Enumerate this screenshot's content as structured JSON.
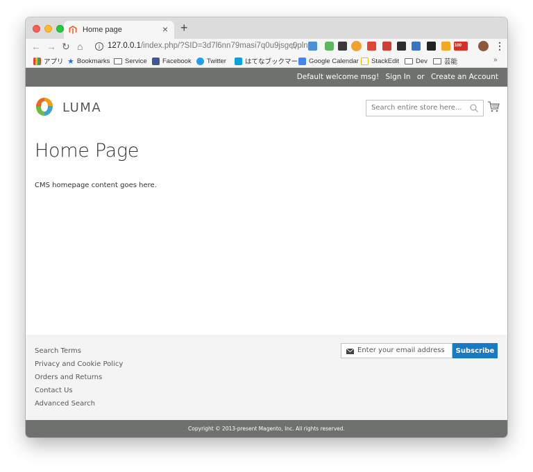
{
  "browser": {
    "tab": {
      "title": "Home page"
    },
    "new_tab_label": "+",
    "address": {
      "host": "127.0.0.1",
      "path": "/index.php/?SID=3d7l6nn79masi7q0u9jsgc0pln"
    },
    "extensions": [
      "puzzle-icon",
      "grid-icon",
      "shield-icon",
      "target-icon",
      "pocket-icon",
      "translate-icon",
      "se-icon",
      "feed-icon",
      "bookmark-icon",
      "graph-icon",
      "gmail-icon",
      "profile-avatar"
    ],
    "gmail_badge": "100",
    "bookmarks": [
      {
        "label": "アプリ",
        "icon": "apps-grid-icon"
      },
      {
        "label": "Bookmarks",
        "icon": "star-icon"
      },
      {
        "label": "Service",
        "icon": "folder-icon"
      },
      {
        "label": "Facebook",
        "icon": "facebook-icon"
      },
      {
        "label": "Twitter",
        "icon": "twitter-icon"
      },
      {
        "label": "はてなブックマーク",
        "icon": "hatena-icon"
      },
      {
        "label": "Google Calendar",
        "icon": "calendar-icon"
      },
      {
        "label": "StackEdit",
        "icon": "stackedit-icon"
      },
      {
        "label": "Dev",
        "icon": "folder-icon"
      },
      {
        "label": "芸能",
        "icon": "folder-icon"
      }
    ],
    "bookmarks_overflow": "»"
  },
  "store": {
    "header": {
      "welcome": "Default welcome msg!",
      "sign_in": "Sign In",
      "or": "or",
      "create_account": "Create an Account"
    },
    "brand": "LUMA",
    "search_placeholder": "Search entire store here...",
    "page_title": "Home Page",
    "content": "CMS homepage content goes here.",
    "footer": {
      "links": [
        "Search Terms",
        "Privacy and Cookie Policy",
        "Orders and Returns",
        "Contact Us",
        "Advanced Search"
      ],
      "newsletter_placeholder": "Enter your email address",
      "subscribe_label": "Subscribe"
    },
    "copyright": "Copyright © 2013-present Magento, Inc. All rights reserved.",
    "colors": {
      "header_bar": "#6e716e",
      "footer_bg": "#f4f4f4",
      "subscribe": "#1979c3"
    }
  }
}
